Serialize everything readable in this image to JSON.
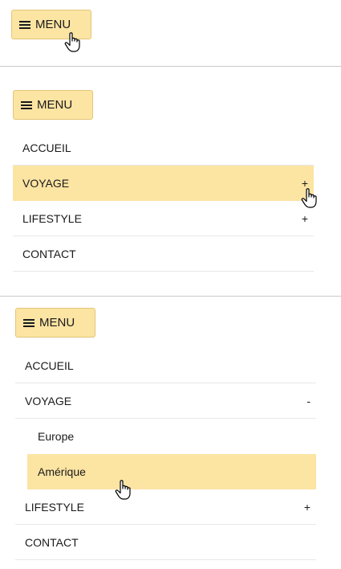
{
  "menu_button": {
    "label": "MENU",
    "icon": "hamburger-icon"
  },
  "accent_color": "#fce4a3",
  "panel_2": {
    "items": [
      {
        "label": "ACCUEIL",
        "toggle": ""
      },
      {
        "label": "VOYAGE",
        "toggle": "+"
      },
      {
        "label": "LIFESTYLE",
        "toggle": "+"
      },
      {
        "label": "CONTACT",
        "toggle": ""
      }
    ]
  },
  "panel_3": {
    "items": [
      {
        "label": "ACCUEIL",
        "toggle": ""
      },
      {
        "label": "VOYAGE",
        "toggle": "-"
      },
      {
        "label": "Europe"
      },
      {
        "label": "Amérique"
      },
      {
        "label": "LIFESTYLE",
        "toggle": "+"
      },
      {
        "label": "CONTACT",
        "toggle": ""
      }
    ]
  }
}
